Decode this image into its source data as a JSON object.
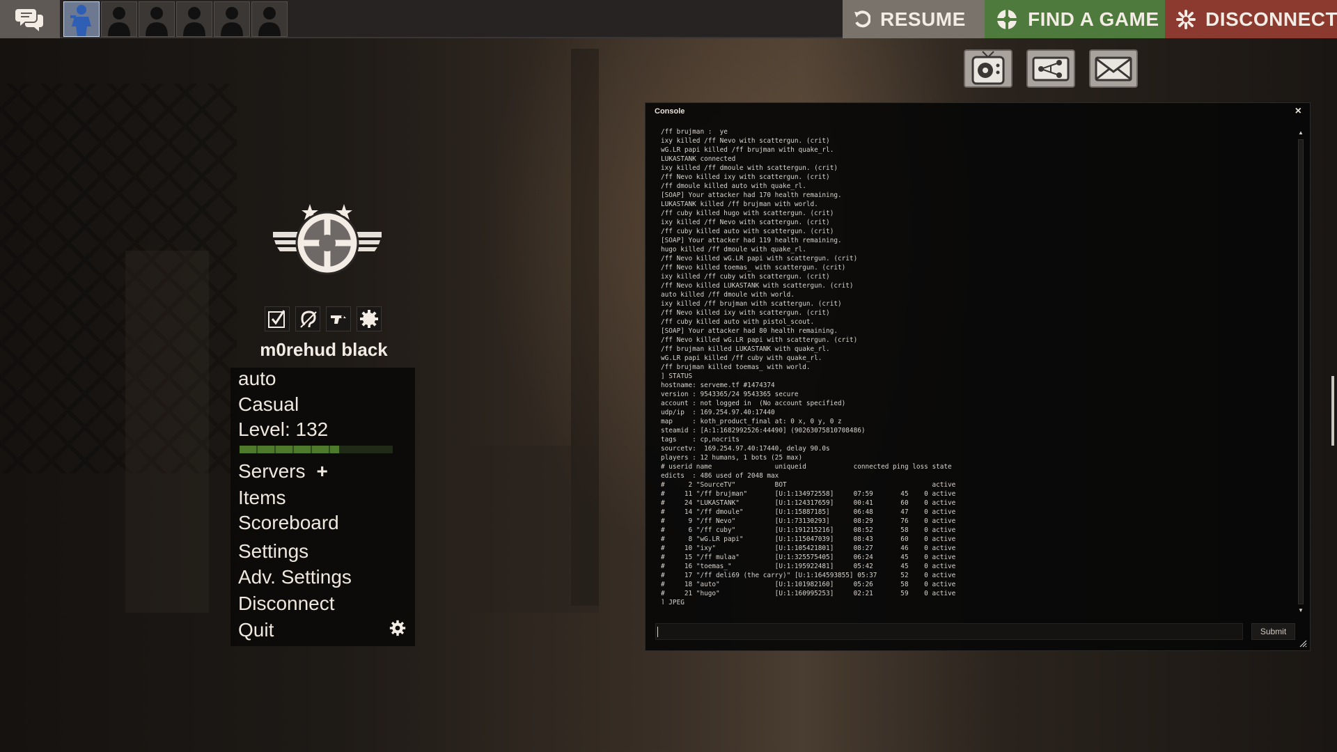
{
  "topbar": {
    "party_slots": [
      "active",
      "empty",
      "empty",
      "empty",
      "empty",
      "empty"
    ],
    "resume_label": "RESUME",
    "find_game_label": "FIND A GAME",
    "disconnect_label": "DISCONNECT"
  },
  "icons": {
    "chat": "chat-bubbles-icon",
    "tv": "tv-icon",
    "network": "server-network-icon",
    "mail": "mail-icon"
  },
  "profile": {
    "username": "m0rehud black",
    "tools": [
      "checkbox-icon",
      "ear-icon",
      "nerf-gun-icon",
      "gear-icon"
    ]
  },
  "menu": {
    "items": [
      "auto",
      "Casual",
      "Level: 132",
      "Servers",
      "Items",
      "Scoreboard",
      "Settings",
      "Adv. Settings",
      "Disconnect",
      "Quit"
    ],
    "servers_plus": "+",
    "level_progress": 0.65
  },
  "console": {
    "title": "Console",
    "close_label": "×",
    "submit_label": "Submit",
    "lines": [
      "/ff brujman :  ye",
      "ixy killed /ff Nevo with scattergun. (crit)",
      "wG.LR papi killed /ff brujman with quake_rl.",
      "LUKASTANK connected",
      "ixy killed /ff dmoule with scattergun. (crit)",
      "/ff Nevo killed ixy with scattergun. (crit)",
      "/ff dmoule killed auto with quake_rl.",
      "[SOAP] Your attacker had 170 health remaining.",
      "LUKASTANK killed /ff brujman with world.",
      "/ff cuby killed hugo with scattergun. (crit)",
      "ixy killed /ff Nevo with scattergun. (crit)",
      "/ff cuby killed auto with scattergun. (crit)",
      "[SOAP] Your attacker had 119 health remaining.",
      "hugo killed /ff dmoule with quake_rl.",
      "/ff Nevo killed wG.LR papi with scattergun. (crit)",
      "/ff Nevo killed toemas_ with scattergun. (crit)",
      "ixy killed /ff cuby with scattergun. (crit)",
      "/ff Nevo killed LUKASTANK with scattergun. (crit)",
      "auto killed /ff dmoule with world.",
      "ixy killed /ff brujman with scattergun. (crit)",
      "/ff Nevo killed ixy with scattergun. (crit)",
      "/ff cuby killed auto with pistol_scout.",
      "[SOAP] Your attacker had 80 health remaining.",
      "/ff Nevo killed wG.LR papi with scattergun. (crit)",
      "/ff brujman killed LUKASTANK with quake_rl.",
      "wG.LR papi killed /ff cuby with quake_rl.",
      "/ff brujman killed toemas_ with world.",
      "] STATUS",
      "hostname: serveme.tf #1474374",
      "version : 9543365/24 9543365 secure",
      "account : not logged in  (No account specified)",
      "udp/ip  : 169.254.97.40:17440",
      "map     : koth_product_final at: 0 x, 0 y, 0 z",
      "steamid : [A:1:1682992526:44490] (90263075810708486)",
      "tags    : cp,nocrits",
      "sourcetv:  169.254.97.40:17440, delay 90.0s",
      "players : 12 humans, 1 bots (25 max)",
      "# userid name                uniqueid            connected ping loss state",
      "edicts  : 486 used of 2048 max",
      "#      2 \"SourceTV\"          BOT                                     active",
      "#     11 \"/ff brujman\"       [U:1:134972558]     07:59       45    0 active",
      "#     24 \"LUKASTANK\"         [U:1:124317659]     00:41       60    0 active",
      "#     14 \"/ff dmoule\"        [U:1:15887185]      06:48       47    0 active",
      "#      9 \"/ff Nevo\"          [U:1:73130293]      08:29       76    0 active",
      "#      6 \"/ff cuby\"          [U:1:191215216]     08:52       58    0 active",
      "#      8 \"wG.LR papi\"        [U:1:115047039]     08:43       60    0 active",
      "#     10 \"ixy\"               [U:1:105421801]     08:27       46    0 active",
      "#     15 \"/ff mulaa\"         [U:1:325575405]     06:24       45    0 active",
      "#     16 \"toemas_\"           [U:1:195922481]     05:42       45    0 active",
      "#     17 \"/ff deli69 (the carry)\" [U:1:164593855] 05:37      52    0 active",
      "#     18 \"auto\"              [U:1:101982160]     05:26       58    0 active",
      "#     21 \"hugo\"              [U:1:160995253]     02:21       59    0 active",
      "] JPEG"
    ]
  },
  "colors": {
    "resume": "#7a736c",
    "find_game": "#4f7a3e",
    "disconnect": "#8c3a30",
    "level_fill": "#4e7a2c"
  }
}
